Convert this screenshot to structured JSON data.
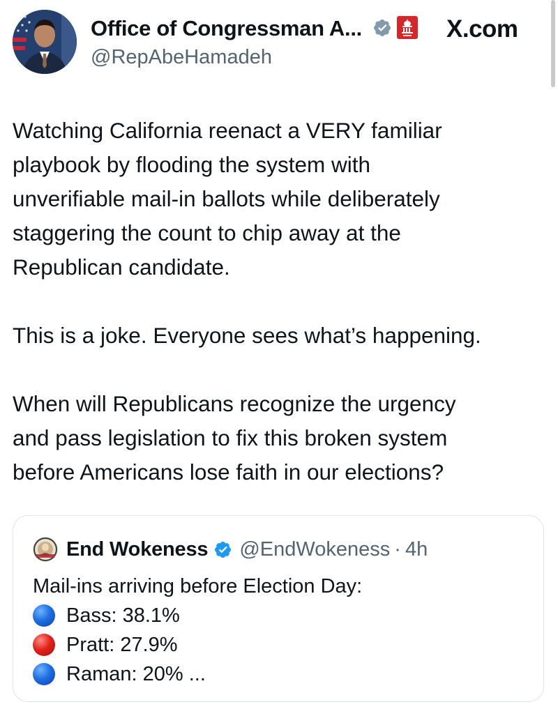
{
  "post": {
    "display_name": "Office of Congressman A...",
    "handle": "@RepAbeHamadeh",
    "site": "X.com",
    "paragraphs": [
      "Watching California reenact a VERY familiar\nplaybook by flooding the system with\nunverifiable mail-in ballots while deliberately\nstaggering the count to chip away at the\nRepublican candidate.",
      "This is a joke. Everyone sees what’s happening.",
      "When will Republicans recognize the urgency\nand pass legislation to fix this broken system\nbefore Americans lose faith in our elections?"
    ]
  },
  "quote": {
    "display_name": "End Wokeness",
    "handle": "@EndWokeness",
    "separator": "·",
    "time": "4h",
    "lines": [
      {
        "text": "Mail-ins arriving before Election Day:"
      },
      {
        "emoji": "blue-circle",
        "text": "Bass: 38.1%"
      },
      {
        "emoji": "red-circle",
        "text": "Pratt: 27.9%"
      },
      {
        "emoji": "blue-circle",
        "text": "Raman: 20% ..."
      }
    ]
  },
  "colors": {
    "text": "#0f1419",
    "secondary": "#536471",
    "verified_gray": "#829aab",
    "verified_blue": "#1d9bf0",
    "gov_red": "#d7262a",
    "card_border": "#dfe4e8"
  }
}
